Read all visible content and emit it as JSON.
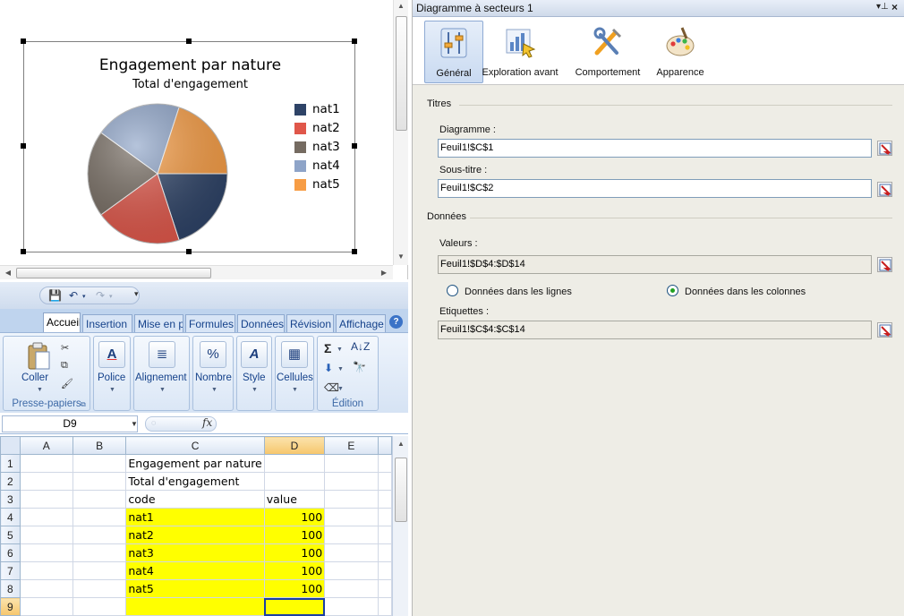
{
  "chart": {
    "title": "Engagement par nature",
    "subtitle": "Total d'engagement"
  },
  "chart_data": {
    "type": "pie",
    "title": "Engagement par nature",
    "subtitle": "Total d'engagement",
    "categories": [
      "nat1",
      "nat2",
      "nat3",
      "nat4",
      "nat5"
    ],
    "values": [
      100,
      100,
      100,
      100,
      100
    ],
    "colors": [
      "#2e4367",
      "#e0574a",
      "#756b61",
      "#8ea4c8",
      "#f79d45"
    ],
    "legend_position": "right"
  },
  "excel": {
    "tabs": [
      "Accueil",
      "Insertion",
      "Mise en p",
      "Formules",
      "Données",
      "Révision",
      "Affichage"
    ],
    "active_tab": "Accueil",
    "groups": {
      "clipboard": {
        "button": "Coller",
        "label": "Presse-papiers"
      },
      "font": {
        "button": "Police"
      },
      "alignment": {
        "button": "Alignement"
      },
      "number": {
        "button": "Nombre"
      },
      "style": {
        "button": "Style"
      },
      "cells": {
        "button": "Cellules"
      },
      "editing": {
        "label": "Édition"
      }
    },
    "name_box": "D9",
    "fx": "fx",
    "columns": [
      "A",
      "B",
      "C",
      "D",
      "E"
    ],
    "rows": [
      {
        "num": "1",
        "c": "Engagement par nature",
        "d": ""
      },
      {
        "num": "2",
        "c": "Total d'engagement",
        "d": ""
      },
      {
        "num": "3",
        "c": "code",
        "d": "value"
      },
      {
        "num": "4",
        "c": "nat1",
        "d": "100"
      },
      {
        "num": "5",
        "c": "nat2",
        "d": "100"
      },
      {
        "num": "6",
        "c": "nat3",
        "d": "100"
      },
      {
        "num": "7",
        "c": "nat4",
        "d": "100"
      },
      {
        "num": "8",
        "c": "nat5",
        "d": "100"
      },
      {
        "num": "9",
        "c": "",
        "d": ""
      }
    ]
  },
  "panel": {
    "title": "Diagramme à secteurs 1",
    "tabs": [
      "Général",
      "Exploration avant",
      "Comportement",
      "Apparence"
    ],
    "active_tab": "Général",
    "sections": {
      "titles": "Titres",
      "data": "Données"
    },
    "chart_label": "Diagramme :",
    "chart_value": "Feuil1!$C$1",
    "subtitle_label": "Sous-titre :",
    "subtitle_value": "Feuil1!$C$2",
    "values_label": "Valeurs :",
    "values_value": "Feuil1!$D$4:$D$14",
    "radio_rows": "Données dans les lignes",
    "radio_cols": "Données dans les colonnes",
    "labels_label": "Etiquettes :",
    "labels_value": "Feuil1!$C$4:$C$14"
  }
}
